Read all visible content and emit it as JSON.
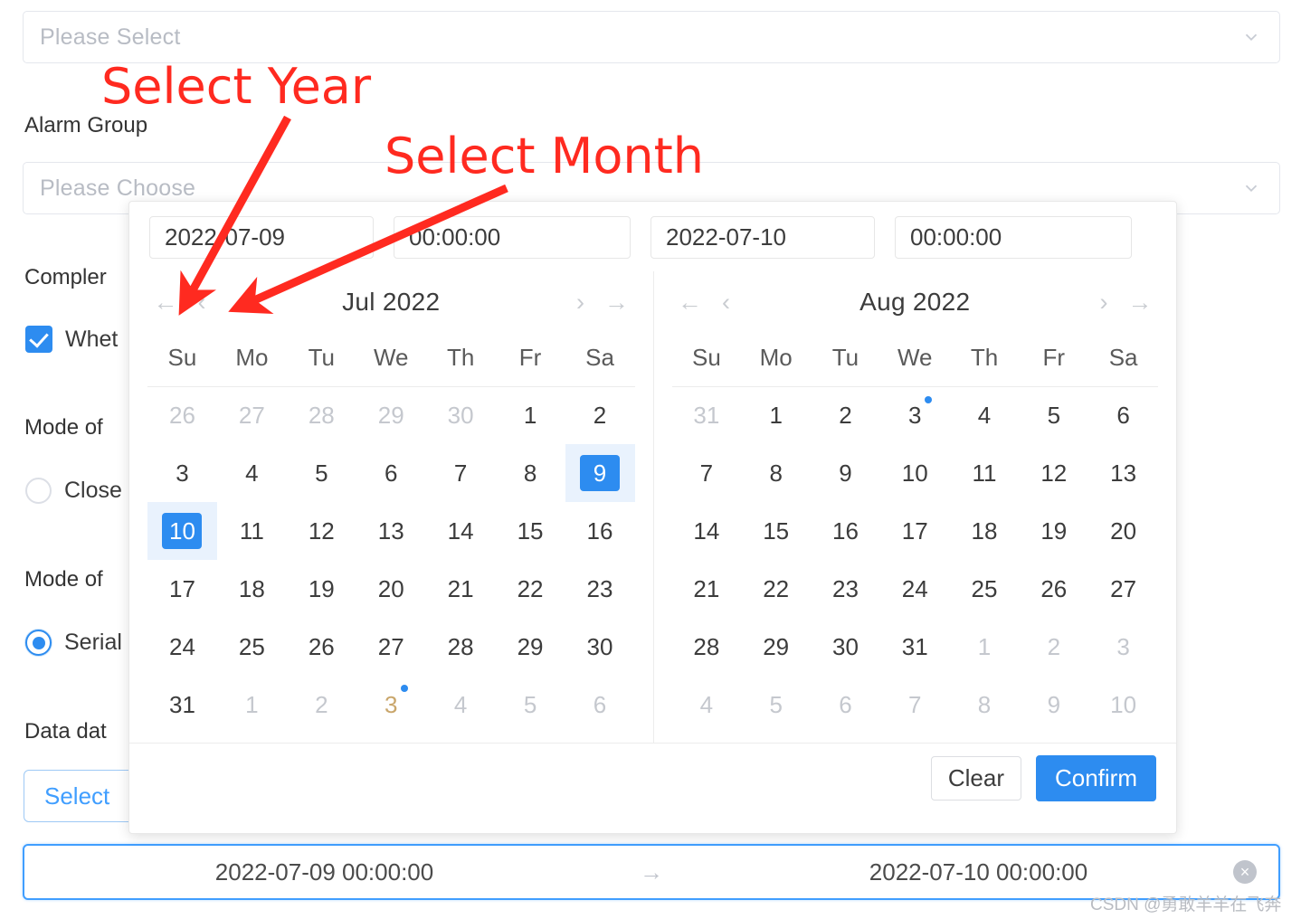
{
  "form": {
    "select_top": {
      "placeholder": "Please Select",
      "icon": "chevron-down-icon"
    },
    "label_alarm_group": "Alarm Group",
    "select_alarm_group": {
      "placeholder": "Please Choose",
      "icon": "chevron-down-icon"
    },
    "label_complement": "Compler",
    "checkbox_whether": {
      "label": "Whet",
      "checked": true
    },
    "label_mode_of_1": "Mode of",
    "radio_close": {
      "label": "Close",
      "checked": false
    },
    "label_mode_of_2": "Mode of",
    "radio_serial": {
      "label": "Serial",
      "checked": true
    },
    "label_data_date": "Data dat",
    "select_button": "Select"
  },
  "range_input": {
    "start": "2022-07-09 00:00:00",
    "arrow": "→",
    "end": "2022-07-10 00:00:00",
    "clear_icon": "×"
  },
  "picker": {
    "inputs": {
      "start_date": "2022-07-09",
      "start_time": "00:00:00",
      "end_date": "2022-07-10",
      "end_time": "00:00:00"
    },
    "nav": {
      "prev_year": "←",
      "prev_month": "‹",
      "next_month": "›",
      "next_year": "→"
    },
    "weekdays": [
      "Su",
      "Mo",
      "Tu",
      "We",
      "Th",
      "Fr",
      "Sa"
    ],
    "left": {
      "title": "Jul 2022",
      "weeks": [
        [
          {
            "d": "26",
            "muted": true
          },
          {
            "d": "27",
            "muted": true
          },
          {
            "d": "28",
            "muted": true
          },
          {
            "d": "29",
            "muted": true
          },
          {
            "d": "30",
            "muted": true
          },
          {
            "d": "1"
          },
          {
            "d": "2"
          }
        ],
        [
          {
            "d": "3"
          },
          {
            "d": "4"
          },
          {
            "d": "5"
          },
          {
            "d": "6"
          },
          {
            "d": "7"
          },
          {
            "d": "8"
          },
          {
            "d": "9",
            "selected": true,
            "range": true
          }
        ],
        [
          {
            "d": "10",
            "selected": true,
            "range": true
          },
          {
            "d": "11"
          },
          {
            "d": "12"
          },
          {
            "d": "13"
          },
          {
            "d": "14"
          },
          {
            "d": "15"
          },
          {
            "d": "16"
          }
        ],
        [
          {
            "d": "17"
          },
          {
            "d": "18"
          },
          {
            "d": "19"
          },
          {
            "d": "20"
          },
          {
            "d": "21"
          },
          {
            "d": "22"
          },
          {
            "d": "23"
          }
        ],
        [
          {
            "d": "24"
          },
          {
            "d": "25"
          },
          {
            "d": "26"
          },
          {
            "d": "27"
          },
          {
            "d": "28"
          },
          {
            "d": "29"
          },
          {
            "d": "30"
          }
        ],
        [
          {
            "d": "31"
          },
          {
            "d": "1",
            "muted": true
          },
          {
            "d": "2",
            "muted": true
          },
          {
            "d": "3",
            "muted": true,
            "today": true,
            "dot": true
          },
          {
            "d": "4",
            "muted": true
          },
          {
            "d": "5",
            "muted": true
          },
          {
            "d": "6",
            "muted": true
          }
        ]
      ]
    },
    "right": {
      "title": "Aug 2022",
      "weeks": [
        [
          {
            "d": "31",
            "muted": true
          },
          {
            "d": "1"
          },
          {
            "d": "2"
          },
          {
            "d": "3",
            "dot": true
          },
          {
            "d": "4"
          },
          {
            "d": "5"
          },
          {
            "d": "6"
          }
        ],
        [
          {
            "d": "7"
          },
          {
            "d": "8"
          },
          {
            "d": "9"
          },
          {
            "d": "10"
          },
          {
            "d": "11"
          },
          {
            "d": "12"
          },
          {
            "d": "13"
          }
        ],
        [
          {
            "d": "14"
          },
          {
            "d": "15"
          },
          {
            "d": "16"
          },
          {
            "d": "17"
          },
          {
            "d": "18"
          },
          {
            "d": "19"
          },
          {
            "d": "20"
          }
        ],
        [
          {
            "d": "21"
          },
          {
            "d": "22"
          },
          {
            "d": "23"
          },
          {
            "d": "24"
          },
          {
            "d": "25"
          },
          {
            "d": "26"
          },
          {
            "d": "27"
          }
        ],
        [
          {
            "d": "28"
          },
          {
            "d": "29"
          },
          {
            "d": "30"
          },
          {
            "d": "31"
          },
          {
            "d": "1",
            "muted": true
          },
          {
            "d": "2",
            "muted": true
          },
          {
            "d": "3",
            "muted": true
          }
        ],
        [
          {
            "d": "4",
            "muted": true
          },
          {
            "d": "5",
            "muted": true
          },
          {
            "d": "6",
            "muted": true
          },
          {
            "d": "7",
            "muted": true
          },
          {
            "d": "8",
            "muted": true
          },
          {
            "d": "9",
            "muted": true
          },
          {
            "d": "10",
            "muted": true
          }
        ]
      ]
    },
    "footer": {
      "clear": "Clear",
      "confirm": "Confirm"
    }
  },
  "annotations": {
    "select_year": "Select Year",
    "select_month": "Select Month"
  },
  "watermark": "CSDN @勇敢羊羊在飞奔",
  "colors": {
    "accent": "#2d8cf0",
    "accent_alt": "#409eff",
    "annotation_red": "#ff2a20",
    "range_bg": "#e9f2fd",
    "muted_text": "#c5c8ce"
  }
}
